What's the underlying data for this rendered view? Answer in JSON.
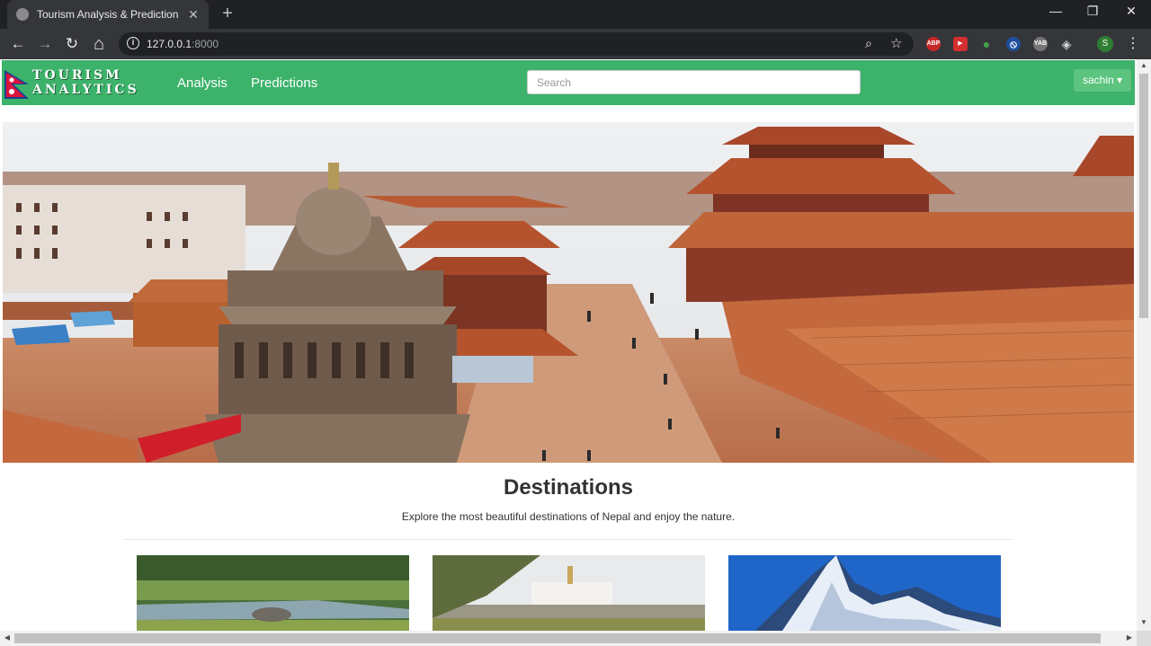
{
  "browser": {
    "tab_title": "Tourism Analysis & Prediction",
    "tab_close": "✕",
    "new_tab": "+",
    "url_host": "127.0.0.1",
    "url_port": ":8000",
    "window": {
      "minimize": "—",
      "restore": "❐",
      "close": "✕"
    },
    "nav": {
      "back": "←",
      "forward": "→",
      "reload": "↻",
      "home": "⌂"
    },
    "extensions": [
      "ABP",
      "▶",
      "●",
      "⦸",
      "YAB",
      "◈"
    ],
    "profile_initial": "S"
  },
  "site": {
    "brand_line1": "Tourism",
    "brand_line2": "Analytics",
    "nav": [
      "Analysis",
      "Predictions"
    ],
    "search_placeholder": "Search",
    "user_label": "sachin ▾",
    "accent_color": "#3cb26a"
  },
  "destinations": {
    "title": "Destinations",
    "subtitle": "Explore the most beautiful destinations of Nepal and enjoy the nature."
  }
}
